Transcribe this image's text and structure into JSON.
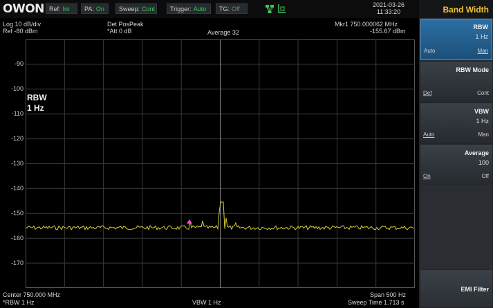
{
  "brand": "OWON",
  "status": {
    "chips": [
      {
        "label": "Ref:",
        "value": "Int",
        "on": true
      },
      {
        "label": "PA:",
        "value": "On",
        "on": true
      },
      {
        "label": "Sweep:",
        "value": "Cont",
        "on": true
      },
      {
        "label": "Trigger:",
        "value": "Auto",
        "on": true
      },
      {
        "label": "TG:",
        "value": "Off",
        "on": false
      }
    ],
    "usb_label": "L",
    "date": "2021-03-26",
    "time": "11:33:20"
  },
  "info": {
    "scale": "Log 10 dB/div",
    "ref": "Ref -80 dBm",
    "detector": "Det PosPeak",
    "attenuation": "*Att 0 dB",
    "average": "Average 32",
    "marker": "Mkr1  750.000062 MHz",
    "marker_level": "-155.67 dBm"
  },
  "y_axis": {
    "ticks": [
      "-90",
      "-100",
      "-110",
      "-120",
      "-130",
      "-140",
      "-150",
      "-160",
      "-170"
    ]
  },
  "annotation": {
    "line1": "RBW",
    "line2": "1 Hz"
  },
  "bottom": {
    "center": "Center 750.000 MHz",
    "rbw": "*RBW 1 Hz",
    "vbw": "VBW 1 Hz",
    "span": "Span 500 Hz",
    "sweep_time": "Sweep Time 1.713 s"
  },
  "panel": {
    "title": "Band Width",
    "items": [
      {
        "title": "RBW",
        "value": "1 Hz",
        "left": "Auto",
        "right": "Man",
        "active": true
      },
      {
        "title": "RBW Mode",
        "value": "",
        "left": "Def",
        "right": "Cont",
        "active": false
      },
      {
        "title": "VBW",
        "value": "1 Hz",
        "left": "Auto",
        "right": "Man",
        "active": false
      },
      {
        "title": "Average",
        "value": "100",
        "left": "On",
        "right": "Off",
        "active": false
      }
    ],
    "emi": "EMI Filter"
  },
  "colors": {
    "trace": "#d8d03a",
    "marker": "#ff4fd8",
    "panel_title": "#f2c233",
    "status_on": "#3fc55c"
  }
}
